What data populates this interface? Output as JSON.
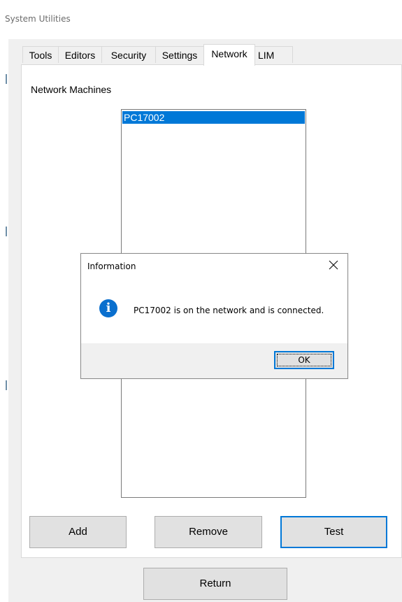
{
  "window": {
    "title": "System Utilities"
  },
  "tabs": [
    {
      "label": "Tools"
    },
    {
      "label": "Editors"
    },
    {
      "label": "Security"
    },
    {
      "label": "Settings"
    },
    {
      "label": "Network",
      "active": true
    },
    {
      "label": "LIM"
    }
  ],
  "network": {
    "section_label": "Network Machines",
    "machines": [
      "PC17002"
    ],
    "selected": "PC17002"
  },
  "buttons": {
    "add": "Add",
    "remove": "Remove",
    "test": "Test",
    "return": "Return"
  },
  "dialog": {
    "title": "Information",
    "close_icon": "close-icon",
    "icon": "info-icon",
    "icon_glyph": "i",
    "message": "PC17002 is on the network and is connected.",
    "ok_label": "OK"
  },
  "colors": {
    "accent": "#0078d7",
    "selection": "#0078d7",
    "info_icon": "#0a6fce"
  }
}
